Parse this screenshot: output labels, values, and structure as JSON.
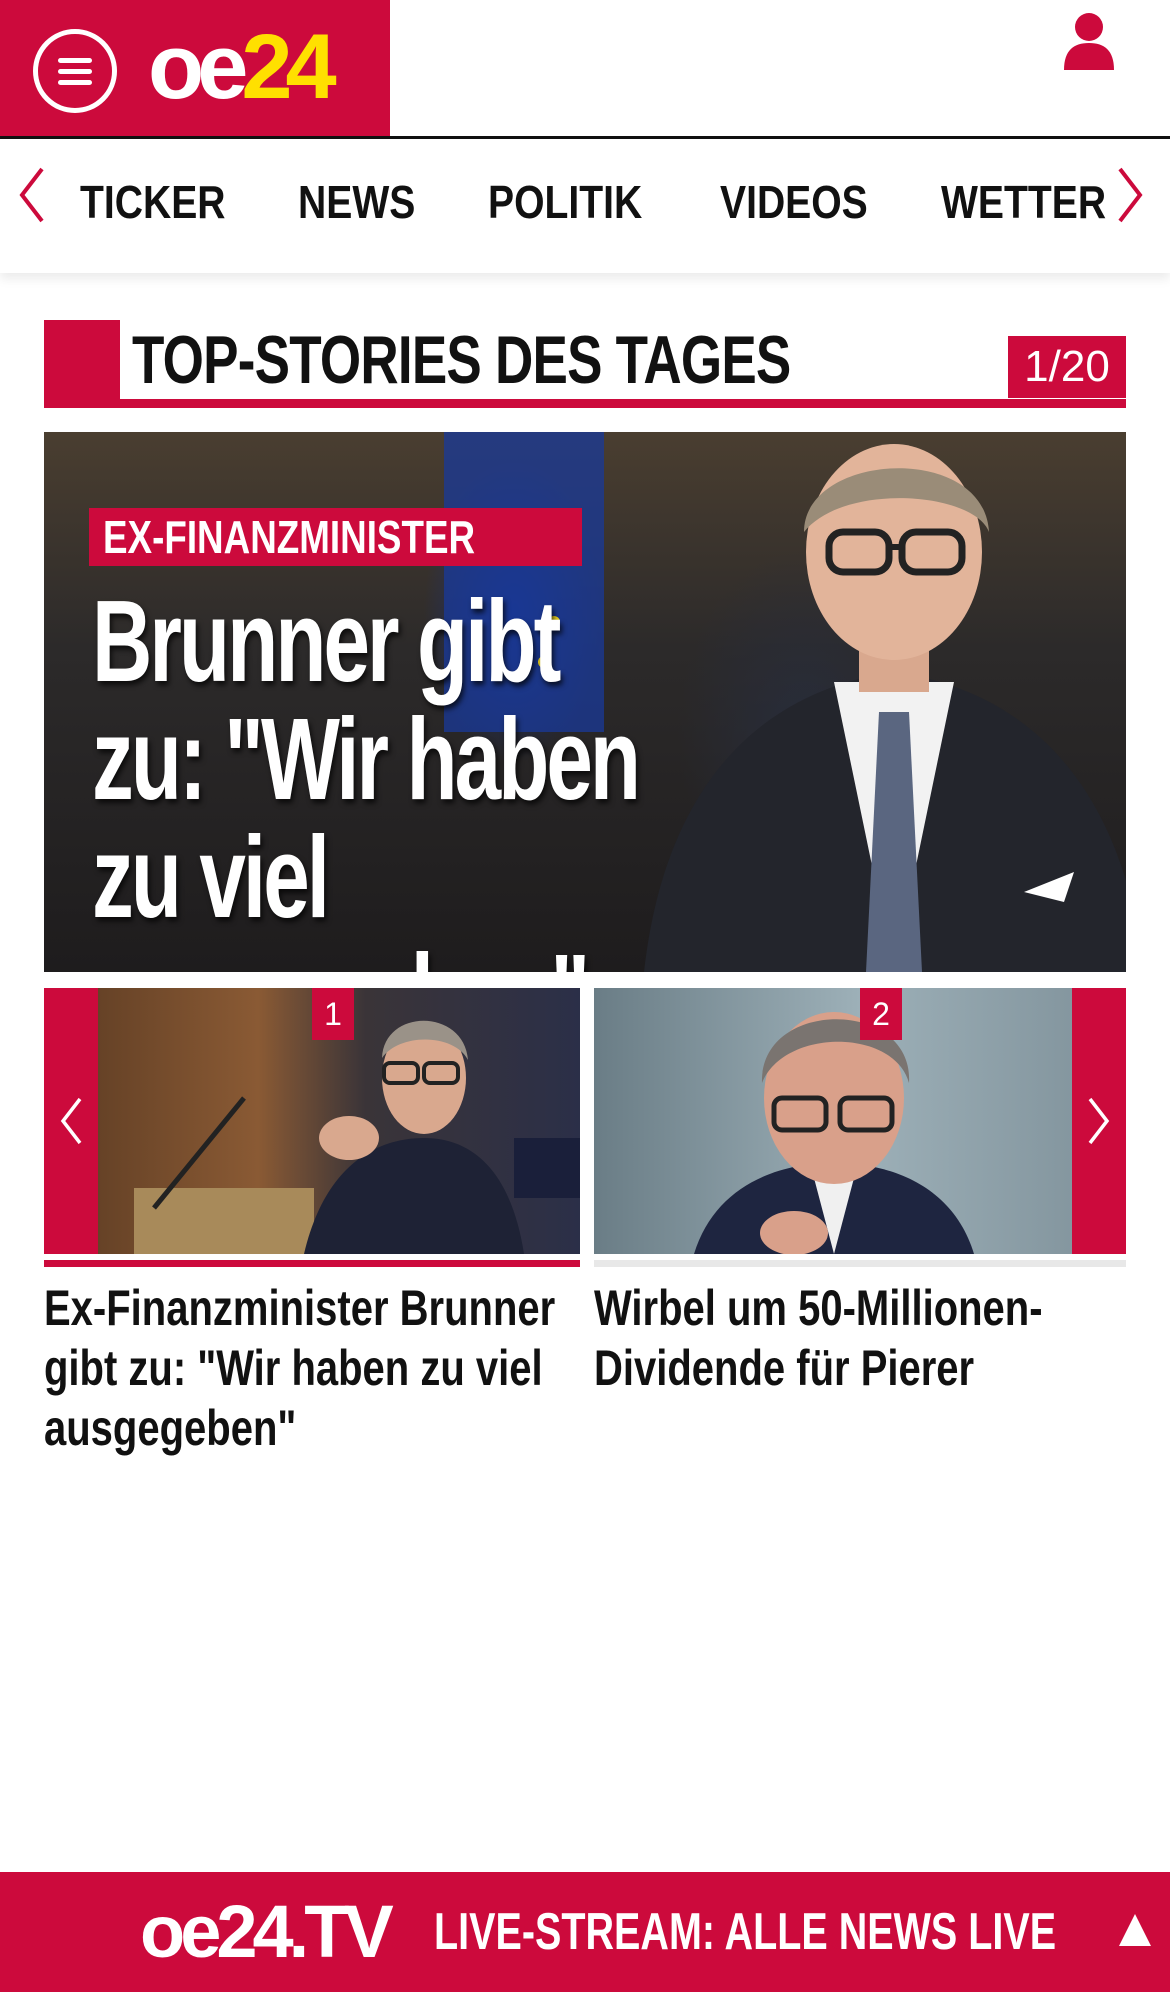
{
  "header": {
    "logo_main": "oe",
    "logo_num": "24",
    "menu_icon": "hamburger-menu-icon",
    "user_icon": "user-icon"
  },
  "nav": {
    "items": [
      "TICKER",
      "NEWS",
      "POLITIK",
      "VIDEOS",
      "WETTER"
    ]
  },
  "section": {
    "title": "TOP-STORIES DES TAGES",
    "counter": "1/20"
  },
  "hero": {
    "kicker": "EX-FINANZMINISTER",
    "headline_line1": "Brunner gibt",
    "headline_line2": "zu: \"Wir haben",
    "headline_line3": "zu viel ausgegeben\""
  },
  "teasers": [
    {
      "number": "1",
      "title": "Ex-Finanzminister Brunner gibt zu: \"Wir haben zu viel ausgegeben\""
    },
    {
      "number": "2",
      "title": "Wirbel um 50-Millionen-Dividende für Pierer"
    }
  ],
  "livebar": {
    "logo": "oe24.TV",
    "text": "LIVE-STREAM:  ALLE NEWS LIVE"
  },
  "colors": {
    "brand_red": "#cc0a3c",
    "logo_yellow": "#ffe000"
  }
}
